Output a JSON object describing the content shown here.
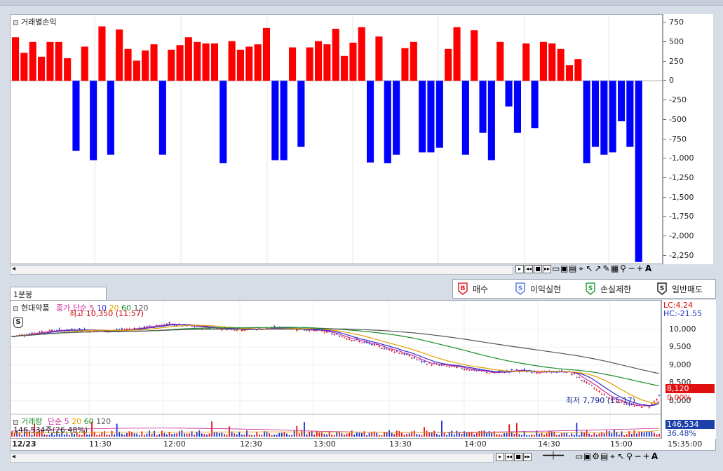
{
  "top_chart": {
    "title": "거래별손익",
    "y_ticks": [
      "750",
      "500",
      "250",
      "0",
      "-250",
      "-500",
      "-750",
      "-1,000",
      "-1,250",
      "-1,500",
      "-1,750",
      "-2,000",
      "-2,250"
    ],
    "y_tick_values": [
      750,
      500,
      250,
      0,
      -250,
      -500,
      -750,
      -1000,
      -1250,
      -1500,
      -1750,
      -2000,
      -2250
    ],
    "toolbar_end_label": "A"
  },
  "chart_data": {
    "type": "bar",
    "title": "거래별손익",
    "ylim": [
      -2350,
      850
    ],
    "values": [
      560,
      360,
      500,
      310,
      500,
      500,
      290,
      -900,
      440,
      -1020,
      700,
      -950,
      660,
      410,
      260,
      390,
      470,
      -950,
      400,
      460,
      560,
      500,
      480,
      480,
      -1060,
      510,
      400,
      440,
      470,
      680,
      -1020,
      -1020,
      430,
      -850,
      430,
      510,
      470,
      670,
      320,
      490,
      690,
      -1050,
      570,
      -1060,
      -950,
      420,
      500,
      -920,
      -920,
      -860,
      410,
      690,
      -950,
      650,
      -670,
      -1020,
      500,
      -330,
      -670,
      480,
      -610,
      500,
      480,
      410,
      200,
      280,
      -1060,
      -850,
      -950,
      -920,
      -520,
      -850,
      -2330
    ],
    "colors": {
      "positive": "#ff0000",
      "negative": "#0000ff"
    }
  },
  "legend": {
    "tab": "1분봉",
    "items": [
      {
        "glyph": "B",
        "label": "매수",
        "color": "#e02020"
      },
      {
        "glyph": "S",
        "label": "이익실현",
        "color": "#5a7bd8"
      },
      {
        "glyph": "S",
        "label": "손실제한",
        "color": "#2aa040"
      },
      {
        "glyph": "S",
        "label": "일반매도",
        "color": "#222222"
      }
    ]
  },
  "price_chart": {
    "symbol": "현대약품",
    "ma_label": "종가 단순",
    "ma_periods": [
      "5",
      "10",
      "20",
      "60",
      "120"
    ],
    "ma_colors": [
      "#cc2a9a",
      "#2f2fd0",
      "#e0a000",
      "#1a8a2a",
      "#555555"
    ],
    "lc": "LC:4.24",
    "hc": "HC:-21.55",
    "high_note": "최고 10,350 (11:57)",
    "low_note": "최저 7,790 (15:17)",
    "y_ticks": [
      "10,000",
      "9,500",
      "9,000",
      "8,500",
      "8,000"
    ],
    "y_tick_values": [
      10000,
      9500,
      9000,
      8500,
      8000
    ],
    "current_price": "8,120",
    "current_change": "0.00%",
    "trade_marker": "S"
  },
  "volume_chart": {
    "title": "거래량",
    "ma_label": "단순",
    "ma_periods": [
      "5",
      "20",
      "60",
      "120"
    ],
    "ma_colors": [
      "#cc2a9a",
      "#e0a000",
      "#1a8a2a",
      "#555555"
    ],
    "info": "146,534주(26.48%)",
    "current_volume": "146,534",
    "current_pct": "36.48%"
  },
  "time_axis": {
    "date": "12/23",
    "labels": [
      "11:30",
      "12:00",
      "12:30",
      "13:00",
      "13:30",
      "14:00",
      "14:30",
      "15:00"
    ],
    "right_label": "15:35:00"
  },
  "bottom_toolbar_end": "A"
}
